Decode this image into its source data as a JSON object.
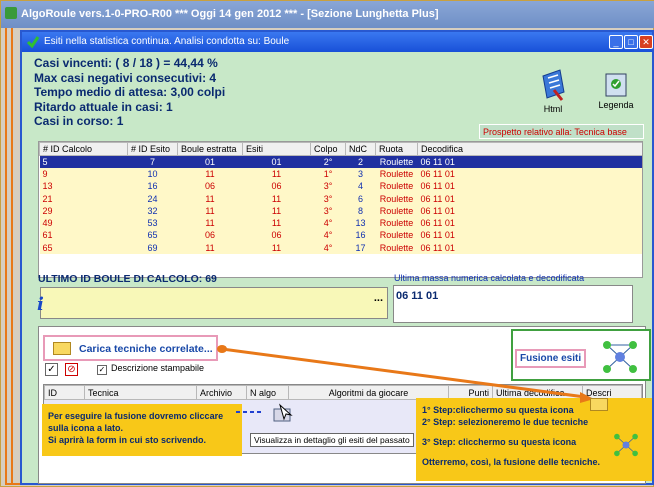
{
  "outer_window": {
    "title": "AlgoRoule vers.1-0-PRO-R00   ***  Oggi 14 gen 2012   ***   - [Sezione Lunghetta Plus]"
  },
  "inner_window": {
    "title": "Esiti nella statistica continua. Analisi condotta su: Boule",
    "buttons": {
      "minimize": "_",
      "maximize": "□",
      "close": "✕"
    }
  },
  "stats": {
    "casi_vincenti": "Casi vincenti: ( 8 / 18 ) = 44,44 %",
    "max_negativi": "Max casi negativi consecutivi: 4",
    "tempo_medio": "Tempo medio di attesa: 3,00 colpi",
    "ritardo": "Ritardo attuale in casi: 1",
    "in_corso": "Casi in corso: 1"
  },
  "toolbar": {
    "html_label": "Html",
    "legenda_label": "Legenda"
  },
  "prospetto": "Prospetto relativo alla: Tecnica base",
  "results_table": {
    "headers": [
      "# ID Calcolo",
      "# ID Esito",
      "Boule estratta",
      "Esiti",
      "Colpo",
      "NdC",
      "Ruota",
      "Decodifica"
    ],
    "rows": [
      {
        "id_calcolo": "5",
        "id_esito": "7",
        "boule": "01",
        "esiti": "01",
        "colpo": "2°",
        "ndc": "2",
        "ruota": "Roulette",
        "decodifica": "06 11 01",
        "style": "sel"
      },
      {
        "id_calcolo": "9",
        "id_esito": "10",
        "boule": "11",
        "esiti": "11",
        "colpo": "1°",
        "ndc": "3",
        "ruota": "Roulette",
        "decodifica": "06 11 01",
        "style": "r"
      },
      {
        "id_calcolo": "13",
        "id_esito": "16",
        "boule": "06",
        "esiti": "06",
        "colpo": "3°",
        "ndc": "4",
        "ruota": "Roulette",
        "decodifica": "06 11 01",
        "style": "r"
      },
      {
        "id_calcolo": "21",
        "id_esito": "24",
        "boule": "11",
        "esiti": "11",
        "colpo": "3°",
        "ndc": "6",
        "ruota": "Roulette",
        "decodifica": "06 11 01",
        "style": "r"
      },
      {
        "id_calcolo": "29",
        "id_esito": "32",
        "boule": "11",
        "esiti": "11",
        "colpo": "3°",
        "ndc": "8",
        "ruota": "Roulette",
        "decodifica": "06 11 01",
        "style": "r"
      },
      {
        "id_calcolo": "49",
        "id_esito": "53",
        "boule": "11",
        "esiti": "11",
        "colpo": "4°",
        "ndc": "13",
        "ruota": "Roulette",
        "decodifica": "06 11 01",
        "style": "r"
      },
      {
        "id_calcolo": "61",
        "id_esito": "65",
        "boule": "06",
        "esiti": "06",
        "colpo": "4°",
        "ndc": "16",
        "ruota": "Roulette",
        "decodifica": "06 11 01",
        "style": "r"
      },
      {
        "id_calcolo": "65",
        "id_esito": "69",
        "boule": "11",
        "esiti": "11",
        "colpo": "4°",
        "ndc": "17",
        "ruota": "Roulette",
        "decodifica": "06 11 01",
        "style": "r"
      }
    ]
  },
  "ultimo": {
    "label": "ULTIMO  ID BOULE DI CALCOLO: 69",
    "dots": "...",
    "massa_label": "Ultima massa numerica calcolata e decodificata",
    "massa_value": "06 11 01"
  },
  "lower": {
    "carica_label": "Carica tecniche correlate...",
    "fusione_label": "Fusione esiti",
    "check_label": "✓",
    "no_label": "⊘",
    "descrizione": "Descrizione stampabile",
    "tech_headers": [
      "ID",
      "Tecnica",
      "Archivio",
      "N algo",
      "Algoritmi da giocare",
      "Punti",
      "Ultima decodifica",
      "Descri"
    ],
    "tooltip": "Visualizza in dettaglio gli esiti del passato"
  },
  "annotations": {
    "left_note": [
      "Per eseguire la fusione dovremo cliccare",
      "sulla icona a lato.",
      "Si aprirà la form in cui sto scrivendo."
    ],
    "step1": "1° Step:clicchermo su questa icona",
    "step2": "2° Step: selezioneremo le due tecniche",
    "step3": "3° Step: clicchermo su questa icona",
    "result": "Otterremo, così, la fusione delle tecniche."
  },
  "colors": {
    "accent": "#1850d8",
    "selected_row": "#2030a0",
    "red_text": "#cc0000",
    "note_bg": "#f8c818"
  }
}
